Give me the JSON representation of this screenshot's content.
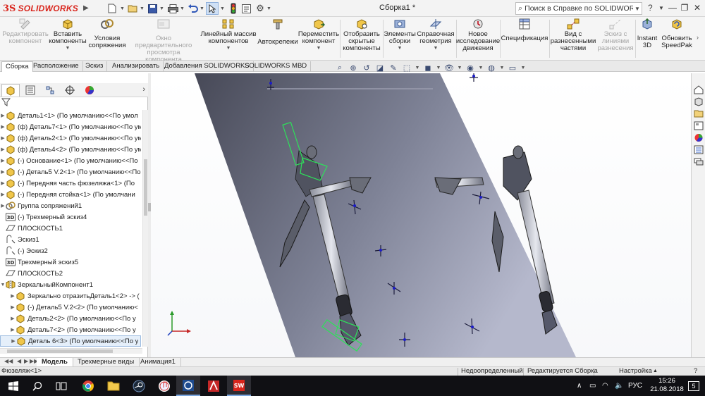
{
  "app": {
    "logo_ds": "3S",
    "logo_text": "SOLIDWORKS",
    "document_title": "Сборка1 *",
    "help_search_placeholder": "Поиск в Справке по SOLIDWORKS"
  },
  "colors": {
    "brand_red": "#d9251c",
    "toolbar_bg": "#f5f5f5",
    "viewport_top": "#ffffff",
    "fuselage_dark": "#474957",
    "fuselage_light": "#b5b8cc",
    "selection_green": "#2ee05a",
    "reference_blue": "#1c1cc8",
    "taskbar_bg": "#101014"
  },
  "command_manager": {
    "buttons": [
      {
        "label_1": "Редактировать",
        "label_2": "компонент",
        "enabled": false,
        "icon": "edit-component-icon"
      },
      {
        "label_1": "Вставить",
        "label_2": "компоненты",
        "enabled": true,
        "icon": "insert-components-icon"
      },
      {
        "label_1": "Условия",
        "label_2": "сопряжения",
        "enabled": true,
        "icon": "mate-icon"
      },
      {
        "label_1": "Окно предварительного",
        "label_2": "просмотра компонента",
        "enabled": false,
        "icon": "preview-window-icon"
      },
      {
        "label_1": "Линейный массив",
        "label_2": "компонентов",
        "enabled": true,
        "icon": "linear-pattern-icon"
      },
      {
        "label_1": "Автокрепежи",
        "label_2": "",
        "enabled": true,
        "icon": "smart-fasteners-icon"
      },
      {
        "label_1": "Переместить",
        "label_2": "компонент",
        "enabled": true,
        "icon": "move-component-icon"
      },
      {
        "label_1": "Отобразить",
        "label_2": "скрытые",
        "label_3": "компоненты",
        "enabled": true,
        "icon": "show-hidden-icon"
      },
      {
        "label_1": "Элементы",
        "label_2": "сборки",
        "enabled": true,
        "icon": "assembly-features-icon"
      },
      {
        "label_1": "Справочная",
        "label_2": "геометрия",
        "enabled": true,
        "icon": "reference-geometry-icon"
      },
      {
        "label_1": "Новое",
        "label_2": "исследование",
        "label_3": "движения",
        "enabled": true,
        "icon": "motion-study-icon"
      },
      {
        "label_1": "Спецификация",
        "label_2": "",
        "enabled": true,
        "icon": "bom-icon"
      },
      {
        "label_1": "Вид с",
        "label_2": "разнесенными",
        "label_3": "частями",
        "enabled": true,
        "icon": "exploded-view-icon"
      },
      {
        "label_1": "Эскиз с",
        "label_2": "линиями",
        "label_3": "разнесения",
        "enabled": false,
        "icon": "explode-line-sketch-icon"
      },
      {
        "label_1": "Instant",
        "label_2": "3D",
        "enabled": true,
        "icon": "instant3d-icon"
      },
      {
        "label_1": "Обновить",
        "label_2": "SpeedPak",
        "enabled": true,
        "icon": "speedpak-icon"
      }
    ]
  },
  "command_tabs": [
    "Сборка",
    "Расположение",
    "Эскиз",
    "Анализировать",
    "Добавления SOLIDWORKS",
    "SOLIDWORKS MBD"
  ],
  "active_command_tab": "Сборка",
  "feature_tree": [
    {
      "label": "Деталь1<1> (По умолчанию<<По умол",
      "type": "part",
      "expandable": true
    },
    {
      "label": "(ф) Деталь7<1> (По умолчанию<<По ум",
      "type": "part",
      "expandable": true
    },
    {
      "label": "(ф) Деталь2<1> (По умолчанию<<По ум",
      "type": "part",
      "expandable": true
    },
    {
      "label": "(ф) Деталь4<2> (По умолчанию<<По ум",
      "type": "part",
      "expandable": true
    },
    {
      "label": "(-) Основание<1> (По умолчанию<<По",
      "type": "part",
      "expandable": true
    },
    {
      "label": "(-) Деталь5 V.2<1> (По умолчанию<<По",
      "type": "part",
      "expandable": true
    },
    {
      "label": "(-) Передняя часть фюзеляжа<1> (По",
      "type": "part",
      "expandable": true
    },
    {
      "label": "(-) Передняя стойка<1> (По умолчани",
      "type": "part",
      "expandable": true
    },
    {
      "label": "Группа сопряжений1",
      "type": "mates",
      "expandable": true
    },
    {
      "label": "(-) Трехмерный эскиз4",
      "type": "sketch3d",
      "expandable": false
    },
    {
      "label": "ПЛОСКОСТЬ1",
      "type": "plane",
      "expandable": false
    },
    {
      "label": "Эскиз1",
      "type": "sketch",
      "expandable": false
    },
    {
      "label": "(-) Эскиз2",
      "type": "sketch",
      "expandable": false
    },
    {
      "label": "Трехмерный эскиз5",
      "type": "sketch3d",
      "expandable": false
    },
    {
      "label": "ПЛОСКОСТЬ2",
      "type": "plane",
      "expandable": false
    },
    {
      "label": "ЗеркальныйКомпонент1",
      "type": "mirror",
      "expandable": true,
      "expanded": true
    },
    {
      "label": "Зеркально отразитьДеталь1<2> -> (",
      "type": "part",
      "expandable": true,
      "indent": 1
    },
    {
      "label": "(-) Деталь5 V.2<2> (По умолчанию<",
      "type": "part",
      "expandable": true,
      "indent": 1
    },
    {
      "label": "Деталь2<2> (По умолчанию<<По у",
      "type": "part",
      "expandable": true,
      "indent": 1
    },
    {
      "label": "Деталь7<2> (По умолчанию<<По у",
      "type": "part",
      "expandable": true,
      "indent": 1
    },
    {
      "label": "Деталь 6<3> (По умолчанию<<По у",
      "type": "part",
      "expandable": true,
      "indent": 1,
      "selected": true
    }
  ],
  "bottom_tabs": [
    "Модель",
    "Трехмерные виды",
    "Анимация1"
  ],
  "active_bottom_tab": "Модель",
  "status": {
    "component": "Фюзеляж<1>",
    "state": "Недоопределенный",
    "editing": "Редактируется Сборка",
    "custom": "Настройка"
  },
  "taskbar": {
    "apps": [
      "start-icon",
      "search-icon",
      "task-view-icon",
      "chrome-icon",
      "explorer-icon",
      "steam-icon",
      "itunes-icon",
      "sw-explorer-icon",
      "autodesk-icon",
      "solidworks-icon"
    ],
    "lang": "РУС",
    "time": "15:26",
    "date": "21.08.2018",
    "notifications": "5"
  }
}
